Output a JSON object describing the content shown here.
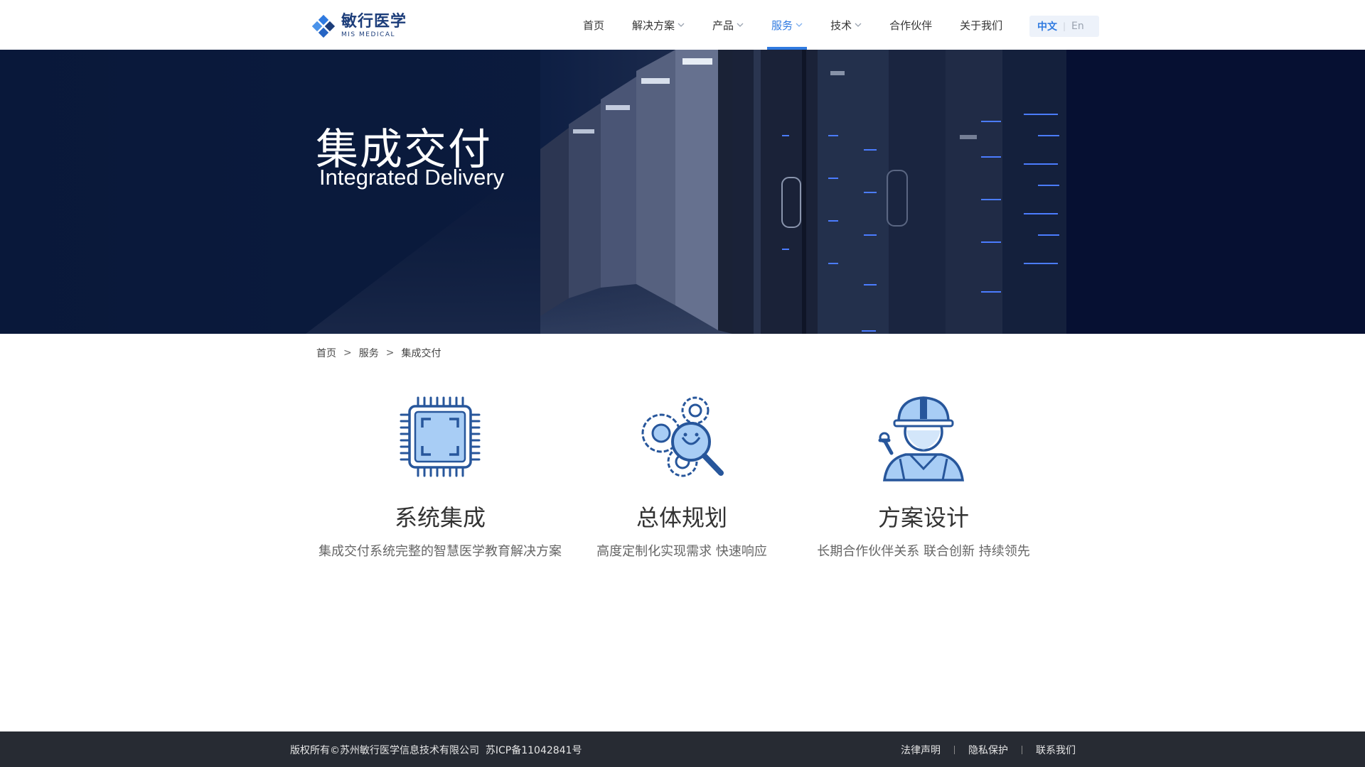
{
  "header": {
    "logo_cn": "敏行医学",
    "logo_en": "MIS MEDICAL",
    "nav": [
      {
        "label": "首页",
        "dropdown": false,
        "active": false
      },
      {
        "label": "解决方案",
        "dropdown": true,
        "active": false
      },
      {
        "label": "产品",
        "dropdown": true,
        "active": false
      },
      {
        "label": "服务",
        "dropdown": true,
        "active": true
      },
      {
        "label": "技术",
        "dropdown": true,
        "active": false
      },
      {
        "label": "合作伙伴",
        "dropdown": false,
        "active": false
      },
      {
        "label": "关于我们",
        "dropdown": false,
        "active": false
      }
    ],
    "lang_zh": "中文",
    "lang_en": "En"
  },
  "banner": {
    "title": "集成交付",
    "subtitle": "Integrated Delivery"
  },
  "breadcrumb": {
    "home": "首页",
    "sep": ">",
    "section": "服务",
    "current": "集成交付"
  },
  "services": [
    {
      "icon": "chip-icon",
      "title": "系统集成",
      "desc": "集成交付系统完整的智慧医学教育解决方案"
    },
    {
      "icon": "gears-magnifier-icon",
      "title": "总体规划",
      "desc": "高度定制化实现需求 快速响应"
    },
    {
      "icon": "engineer-icon",
      "title": "方案设计",
      "desc": "长期合作伙伴关系 联合创新 持续领先"
    }
  ],
  "footer": {
    "copyright": "版权所有©苏州敏行医学信息技术有限公司  苏ICP备11042841号",
    "links": [
      "法律声明",
      "隐私保护",
      "联系我们"
    ]
  },
  "colors": {
    "accent": "#2f7ae0",
    "brand": "#1c3d7a",
    "banner_bg": "#0a1838",
    "footer_bg": "#272b33",
    "icon_fill": "#a8cdf5",
    "icon_stroke": "#27569b"
  }
}
